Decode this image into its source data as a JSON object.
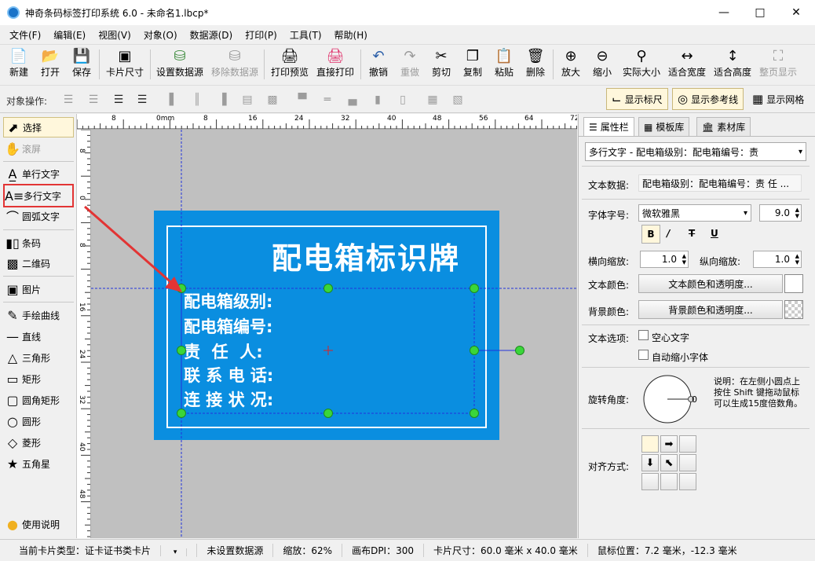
{
  "window": {
    "title": "神奇条码标签打印系统 6.0 - 未命名1.lbcp*"
  },
  "menu": [
    "文件(F)",
    "编辑(E)",
    "视图(V)",
    "对象(O)",
    "数据源(D)",
    "打印(P)",
    "工具(T)",
    "帮助(H)"
  ],
  "toolbar": {
    "new": "新建",
    "open": "打开",
    "save": "保存",
    "card_size": "卡片尺寸",
    "set_datasource": "设置数据源",
    "remove_datasource": "移除数据源",
    "print_preview": "打印预览",
    "direct_print": "直接打印",
    "undo": "撤销",
    "redo": "重做",
    "cut": "剪切",
    "copy": "复制",
    "paste": "粘贴",
    "delete": "删除",
    "zoom_in": "放大",
    "zoom_out": "缩小",
    "actual_size": "实际大小",
    "fit_width": "适合宽度",
    "fit_height": "适合高度",
    "full_page": "整页显示"
  },
  "objbar": {
    "label": "对象操作:",
    "show_ruler": "显示标尺",
    "show_guides": "显示参考线",
    "show_grid": "显示网格"
  },
  "tools": {
    "select": "选择",
    "scroll": "滚屏",
    "single_text": "单行文字",
    "multi_text": "多行文字",
    "arc_text": "圆弧文字",
    "barcode": "条码",
    "qrcode": "二维码",
    "image": "图片",
    "freehand": "手绘曲线",
    "line": "直线",
    "triangle": "三角形",
    "rect": "矩形",
    "round_rect": "圆角矩形",
    "circle": "圆形",
    "diamond": "菱形",
    "star": "五角星",
    "help": "使用说明"
  },
  "ruler_h": [
    "8",
    "0mm",
    "8",
    "16",
    "24",
    "32",
    "40",
    "48",
    "56",
    "64",
    "72"
  ],
  "ruler_v": [
    "8",
    "0",
    "8",
    "16",
    "24",
    "32",
    "40",
    "48"
  ],
  "card": {
    "title": "配电箱标识牌",
    "lines": [
      "配电箱级别:",
      "配电箱编号:",
      "责  任  人:",
      "联 系 电 话:",
      "连 接 状 况:"
    ]
  },
  "panel": {
    "tabs": [
      "属性栏",
      "模板库",
      "素材库"
    ],
    "object_select": "多行文字 - 配电箱级别：配电箱编号：责",
    "text_data_label": "文本数据:",
    "text_data_value": "配电箱级别：配电箱编号：责  任 ...",
    "font_label": "字体字号:",
    "font_name": "微软雅黑",
    "font_size": "9.0",
    "hscale_label": "横向缩放:",
    "hscale": "1.0",
    "vscale_label": "纵向缩放:",
    "vscale": "1.0",
    "text_color_label": "文本颜色:",
    "text_color_btn": "文本颜色和透明度...",
    "bg_color_label": "背景颜色:",
    "bg_color_btn": "背景颜色和透明度...",
    "text_options_label": "文本选项:",
    "hollow_text": "空心文字",
    "auto_shrink": "自动缩小字体",
    "rotation_label": "旋转角度:",
    "rotation_value": "0",
    "rotation_note": "说明：在左侧小圆点上按住 Shift 键拖动鼠标可以生成15度倍数角。",
    "align_label": "对齐方式:"
  },
  "status": {
    "card_type": "当前卡片类型：证卡证书类卡片",
    "datasource": "未设置数据源",
    "zoom": "缩放：62%",
    "dpi": "画布DPI：300",
    "card_size": "卡片尺寸：60.0 毫米 x 40.0 毫米",
    "mouse_pos": "鼠标位置：7.2 毫米，-12.3 毫米"
  },
  "colors": {
    "card_bg": "#0a8ee0",
    "canvas_bg": "#c0c0c0",
    "handle": "#3ad63a",
    "arrow": "#e23434"
  }
}
